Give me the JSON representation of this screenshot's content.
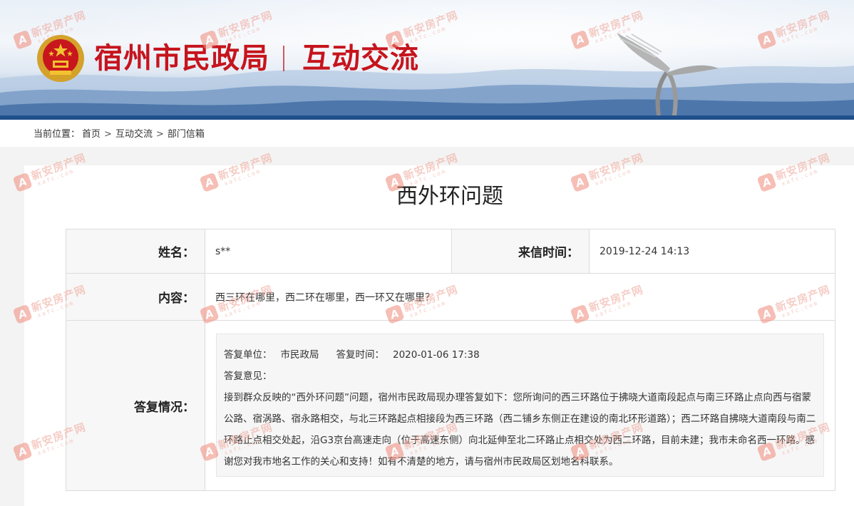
{
  "header": {
    "site_title": "宿州市民政局",
    "section_title": "互动交流"
  },
  "breadcrumb": {
    "prefix": "当前位置：",
    "items": [
      "首页",
      "互动交流",
      "部门信箱"
    ],
    "separator": ">"
  },
  "letter": {
    "title": "西外环问题",
    "name_label": "姓名：",
    "name_value": "s**",
    "time_label": "来信时间：",
    "time_value": "2019-12-24 14:13",
    "content_label": "内容：",
    "content_value": "西三环在哪里，西二环在哪里，西一环又在哪里？",
    "reply_label": "答复情况："
  },
  "reply": {
    "unit_label": "答复单位：",
    "unit_value": "市民政局",
    "time_label": "答复时间：",
    "time_value": "2020-01-06 17:38",
    "opinion_label": "答复意见：",
    "opinion_text": "接到群众反映的“西外环问题”问题，宿州市民政局现办理答复如下：您所询问的西三环路位于拂晓大道南段起点与南三环路止点向西与宿蒙公路、宿涡路、宿永路相交，与北三环路起点相接段为西三环路（西二铺乡东侧正在建设的南北环形道路）；西二环路自拂晓大道南段与南二环路止点相交处起，沿G3京台高速走向（位于高速东侧）向北延伸至北二环路止点相交处为西二环路，目前未建；我市未命名西一环路。感谢您对我市地名工作的关心和支持！如有不清楚的地方，请与宿州市民政局区划地名科联系。"
  },
  "watermark": {
    "text": "新安房产网",
    "sub": "xafc.com",
    "logo_letter": "A"
  },
  "colors": {
    "brand_red": "#c6141d",
    "banner_blue": "#1f4f8c"
  }
}
